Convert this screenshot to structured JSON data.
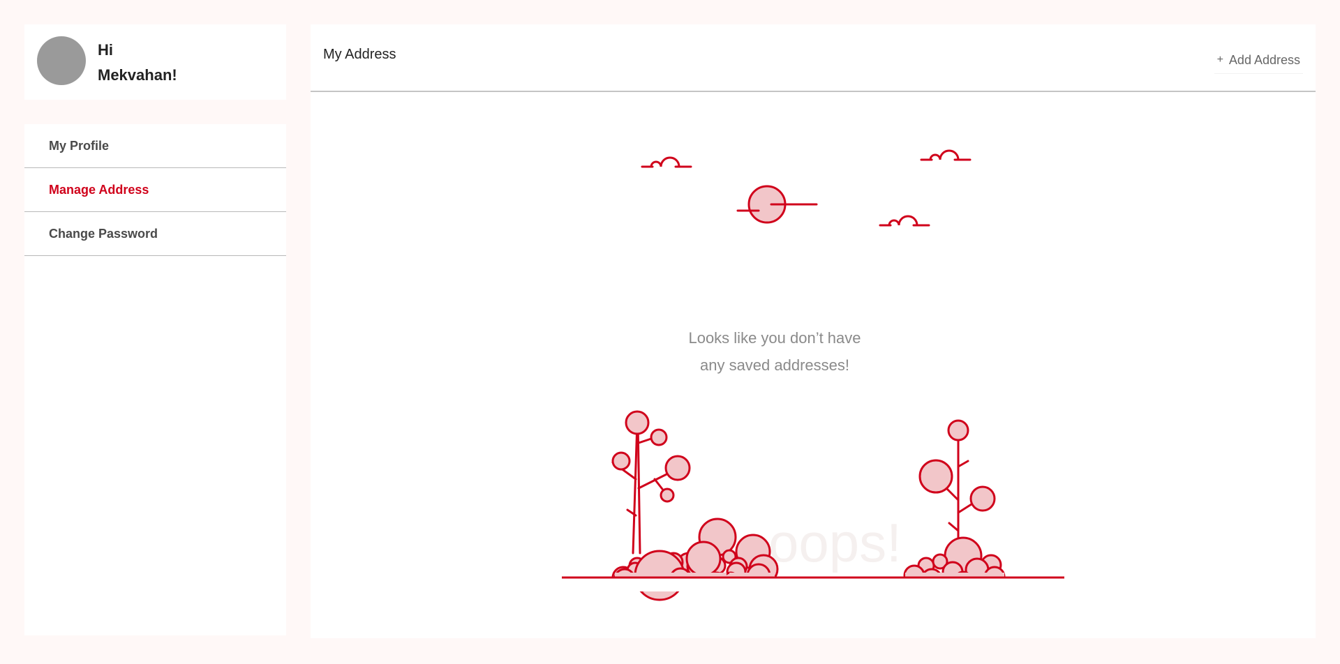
{
  "profile": {
    "greeting_hi": "Hi",
    "greeting_name": "Mekvahan!"
  },
  "menu": {
    "items": [
      {
        "label": "My Profile",
        "active": false
      },
      {
        "label": "Manage Address",
        "active": true
      },
      {
        "label": "Change Password",
        "active": false
      }
    ]
  },
  "main": {
    "title": "My Address",
    "add_button_icon": "+",
    "add_button_label": "Add Address",
    "empty_line1": "Looks like you don’t have",
    "empty_line2": "any saved addresses!",
    "oops_text": "oops!"
  },
  "colors": {
    "accent": "#d0021b",
    "illustration_fill": "#f2c6c9",
    "background": "#fff8f7"
  },
  "icons": {
    "add": "plus-icon",
    "avatar": "avatar-placeholder"
  }
}
